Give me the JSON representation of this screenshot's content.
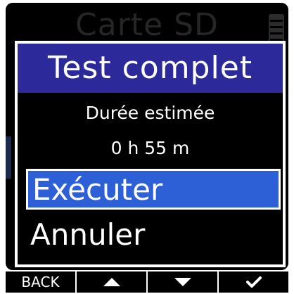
{
  "background_screen": {
    "title": "Carte SD",
    "battery_icon": "battery-icon"
  },
  "dialog": {
    "title": "Test complet",
    "estimated_label": "Durée estimée",
    "estimated_value": "0 h 55 m",
    "options": [
      {
        "label": "Exécuter",
        "selected": true
      },
      {
        "label": "Annuler",
        "selected": false
      }
    ],
    "colors": {
      "header_bg": "#2c2a9a",
      "selection_bg": "#2d5fd6",
      "text": "#ffffff",
      "background": "#000000"
    }
  },
  "softkeys": {
    "back_label": "BACK",
    "up_icon": "triangle-up-icon",
    "down_icon": "triangle-down-icon",
    "confirm_icon": "checkmark-icon"
  }
}
